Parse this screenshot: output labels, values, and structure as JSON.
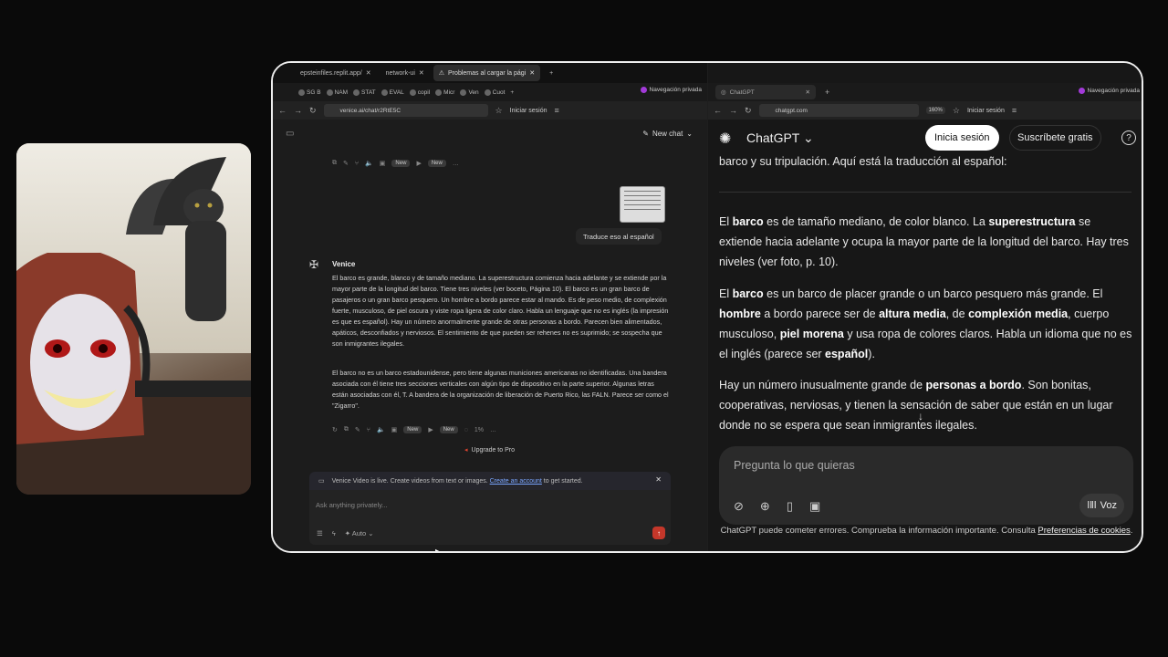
{
  "left_browser": {
    "top_tabs": [
      "epsteinfiles.replit.app/",
      "network-ui",
      "Problemas al cargar la pági"
    ],
    "bookmarks": [
      "SG B",
      "NAM",
      "STAT",
      "EVAL",
      "copil",
      "Micr",
      "Ven",
      "Cuot"
    ],
    "private_label": "Navegación privada",
    "url": "venice.ai/chat/r2RtE5C",
    "signin": "Iniciar sesión"
  },
  "venice": {
    "new_chat": "New chat",
    "new_badge": "New",
    "user_message": "Traduce eso al español",
    "bot_name": "Venice",
    "paragraph1": "El barco es grande, blanco y de tamaño mediano. La superestructura comienza hacia adelante y se extiende por la mayor parte de la longitud del barco. Tiene tres niveles (ver boceto, Página 10). El barco es un gran barco de pasajeros o un gran barco pesquero. Un hombre a bordo parece estar al mando. Es de peso medio, de complexión fuerte, musculoso, de piel oscura y viste ropa ligera de color claro. Habla un lenguaje que no es inglés (la impresión es que es español). Hay un número anormalmente grande de otras personas a bordo. Parecen bien alimentados, apáticos, desconfiados y nerviosos. El sentimiento de que pueden ser rehenes no es suprimido; se sospecha que son inmigrantes ilegales.",
    "paragraph2": "El barco no es un barco estadounidense, pero tiene algunas municiones americanas no identificadas. Una bandera asociada con él tiene tres secciones verticales con algún tipo de dispositivo en la parte superior. Algunas letras están asociadas con él, T. A bandera de la organización de liberación de Puerto Rico, las FALN. Parece ser como el \"Zigarro\".",
    "percent": "1%",
    "upgrade": "Upgrade to Pro",
    "notice_text": "Venice Video is live. Create videos from text or images.",
    "notice_link": "Create an account",
    "notice_tail": "to get started.",
    "input_placeholder": "Ask anything privately...",
    "mode": "Auto"
  },
  "right_browser": {
    "tab": "ChatGPT",
    "private_label": "Navegación privada",
    "url": "chatgpt.com",
    "zoom": "160%",
    "signin": "Iniciar sesión"
  },
  "chatgpt": {
    "title": "ChatGPT",
    "login": "Inicia sesión",
    "signup": "Suscríbete gratis",
    "intro": "barco y su tripulación. Aquí está la traducción al español:",
    "p1": [
      "El ",
      "barco",
      " es de tamaño mediano, de color blanco. La ",
      "superestructura",
      " se extiende hacia adelante y ocupa la mayor parte de la longitud del barco. Hay tres niveles (ver foto, p. 10)."
    ],
    "p2": [
      "El ",
      "barco",
      " es un barco de placer grande o un barco pesquero más grande. El ",
      "hombre",
      " a bordo parece ser de ",
      "altura media",
      ", de ",
      "complexión media",
      ", cuerpo musculoso, ",
      "piel morena",
      " y usa ropa de colores claros. Habla un idioma que no es el inglés (parece ser ",
      "español",
      ")."
    ],
    "p3": [
      "Hay un número inusualmente grande de ",
      "personas a bordo",
      ". Son bonitas, cooperativas, nerviosas, y tienen la sensación de saber que están en un lugar donde no se espera que sean inmigrantes ilegales."
    ],
    "input_placeholder": "Pregunta lo que quieras",
    "voice": "Voz",
    "disclaimer": "ChatGPT puede cometer errores. Comprueba la información importante. Consulta",
    "disclaimer_link": "Preferencias de cookies",
    "disclaimer_end": "."
  }
}
